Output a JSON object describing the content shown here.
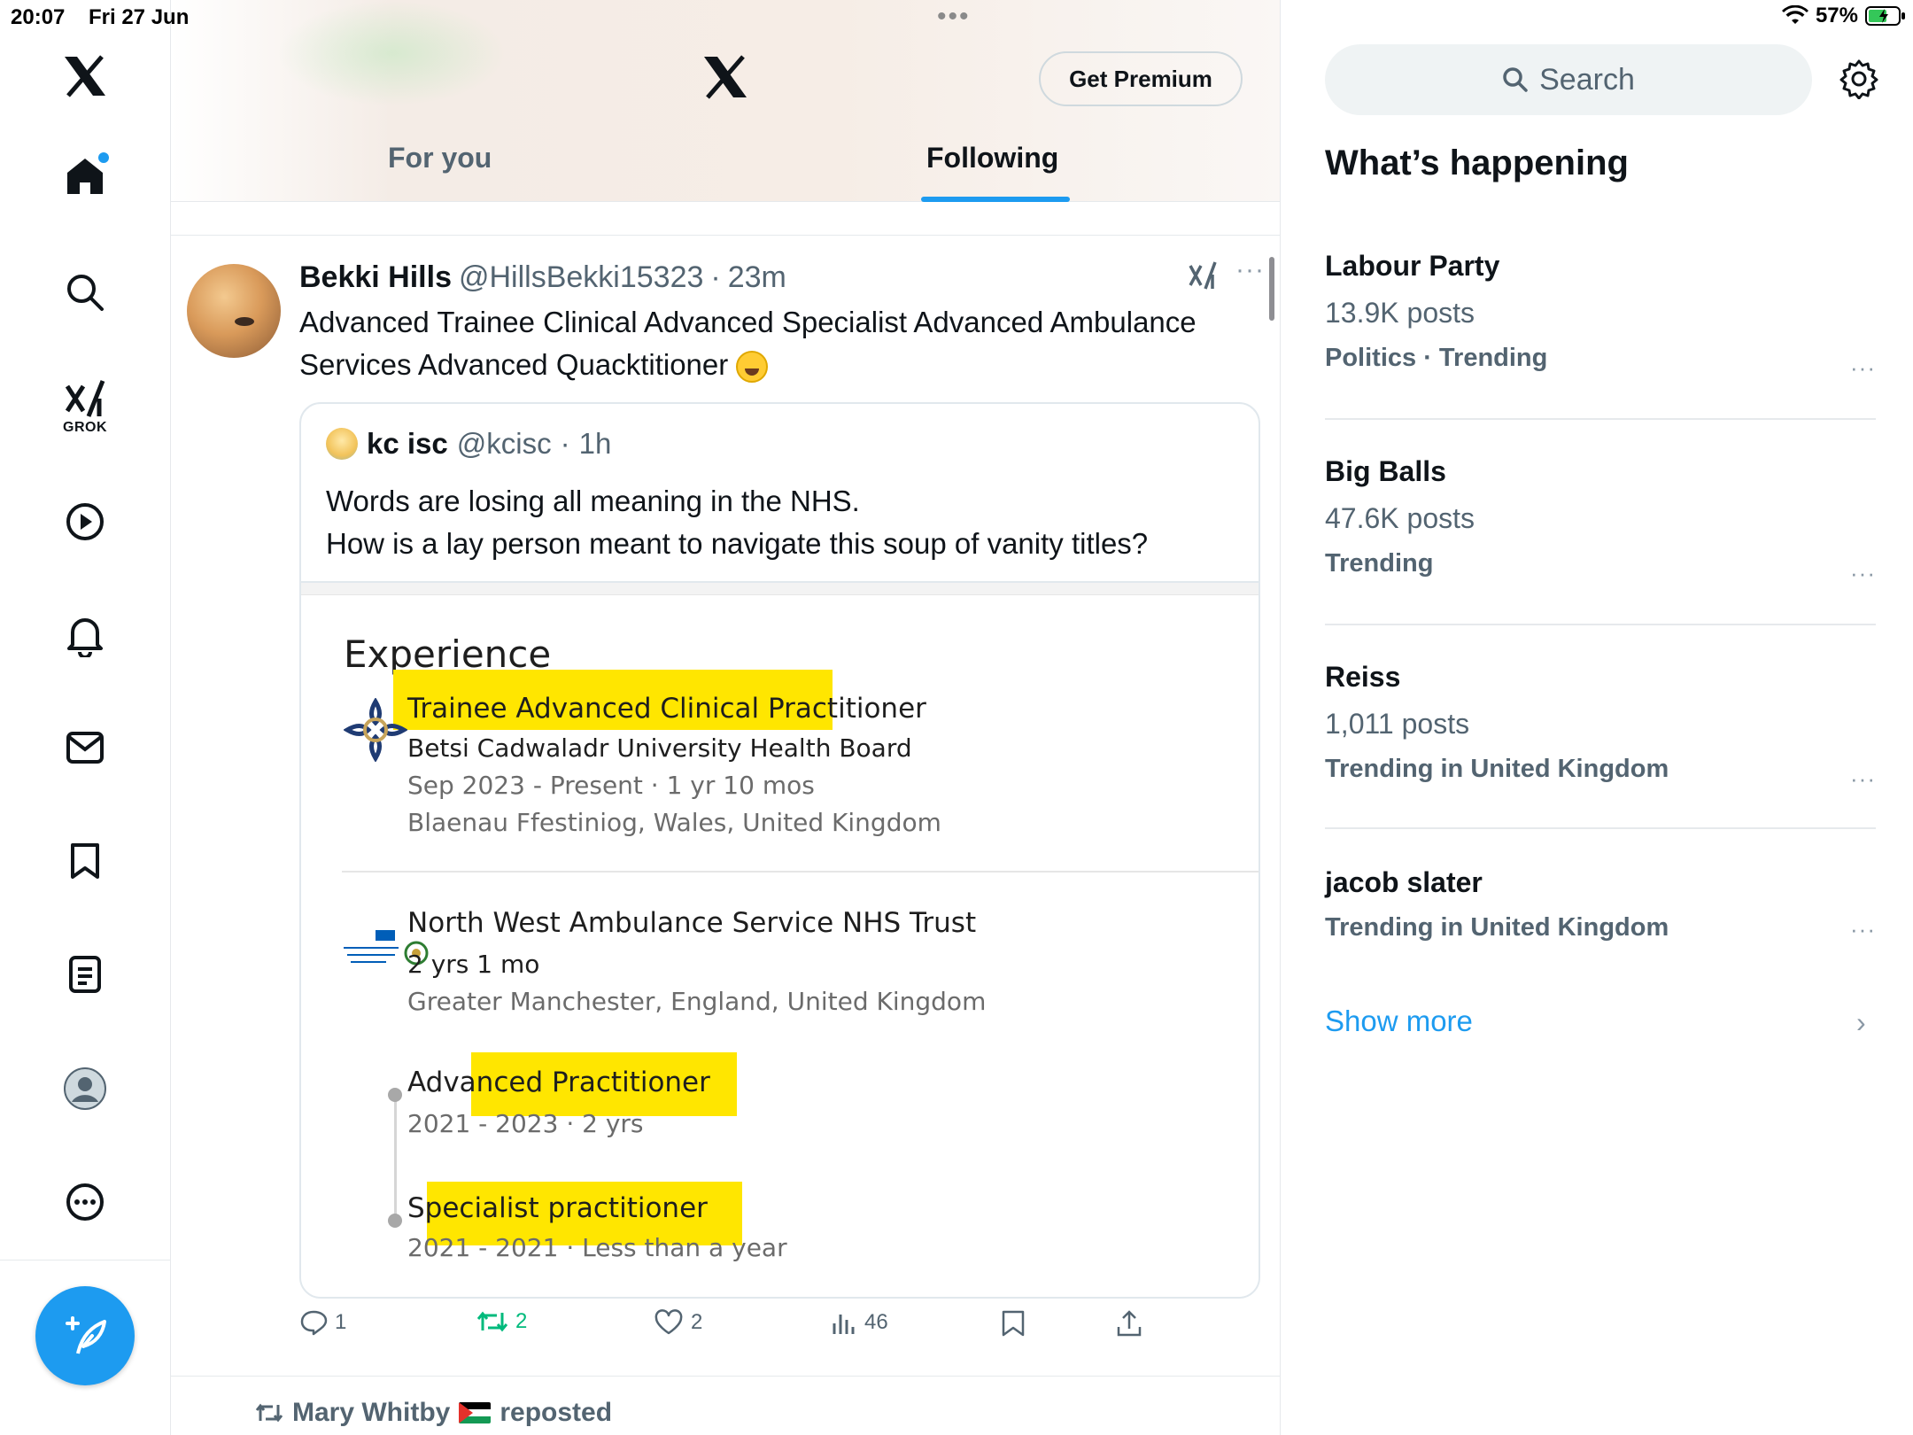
{
  "status_bar": {
    "time": "20:07",
    "date": "Fri 27 Jun",
    "battery": "57%",
    "dots": "•••"
  },
  "nav": {
    "icons": [
      "x-logo-icon",
      "home-icon",
      "search-icon",
      "grok-icon",
      "video-icon",
      "notifications-icon",
      "messages-icon",
      "bookmarks-icon",
      "lists-icon",
      "profile-icon",
      "more-icon",
      "compose-icon"
    ],
    "grok_label": "GROK",
    "accent": "#1d9bf0"
  },
  "header": {
    "premium_label": "Get Premium",
    "tabs": [
      {
        "label": "For you",
        "active": false
      },
      {
        "label": "Following",
        "active": true
      }
    ]
  },
  "tweet": {
    "name": "Bekki Hills",
    "handle": "@HillsBekki15323",
    "dot": "·",
    "time": "23m",
    "text": "Advanced Trainee Clinical Advanced Specialist Advanced  Ambulance Services Advanced Quacktitioner",
    "more": "···",
    "quote": {
      "name": "kc isc",
      "handle": "@kcisc",
      "dot": "·",
      "time": "1h",
      "text_line1": "Words are losing all meaning in the NHS.",
      "text_line2": "How is a lay person meant to navigate this soup of vanity titles?",
      "image": {
        "heading": "Experience",
        "highlight_color": "#ffe600",
        "job1": {
          "role": "Trainee Advanced Clinical Practitioner",
          "org": "Betsi Cadwaladr University Health Board",
          "dates": "Sep 2023 - Present · 1 yr 10 mos",
          "location": "Blaenau Ffestiniog, Wales, United Kingdom"
        },
        "job2": {
          "org": "North West Ambulance Service NHS Trust",
          "duration": "2 yrs 1 mo",
          "location": "Greater Manchester, England, United Kingdom",
          "roles": [
            {
              "title": "Advanced Practitioner",
              "dates": "2021 - 2023 · 2 yrs"
            },
            {
              "title": "Specialist practitioner",
              "dates": "2021 - 2021 · Less than a year"
            }
          ]
        }
      }
    },
    "actions": {
      "replies": "1",
      "reposts": "2",
      "likes": "2",
      "views": "46"
    }
  },
  "next": {
    "reposter": "Mary Whitby",
    "reposted": "reposted"
  },
  "sidebar": {
    "search_placeholder": "Search",
    "title": "What’s happening",
    "more": "···",
    "trends": [
      {
        "name": "Labour Party",
        "posts": "13.9K posts",
        "category": "Politics · Trending"
      },
      {
        "name": "Big Balls",
        "posts": "47.6K posts",
        "category": "Trending"
      },
      {
        "name": "Reiss",
        "posts": "1,011 posts",
        "category": "Trending in United Kingdom"
      },
      {
        "name": "jacob slater",
        "category": "Trending in United Kingdom"
      }
    ],
    "show_more": "Show more",
    "chevron": "›"
  }
}
